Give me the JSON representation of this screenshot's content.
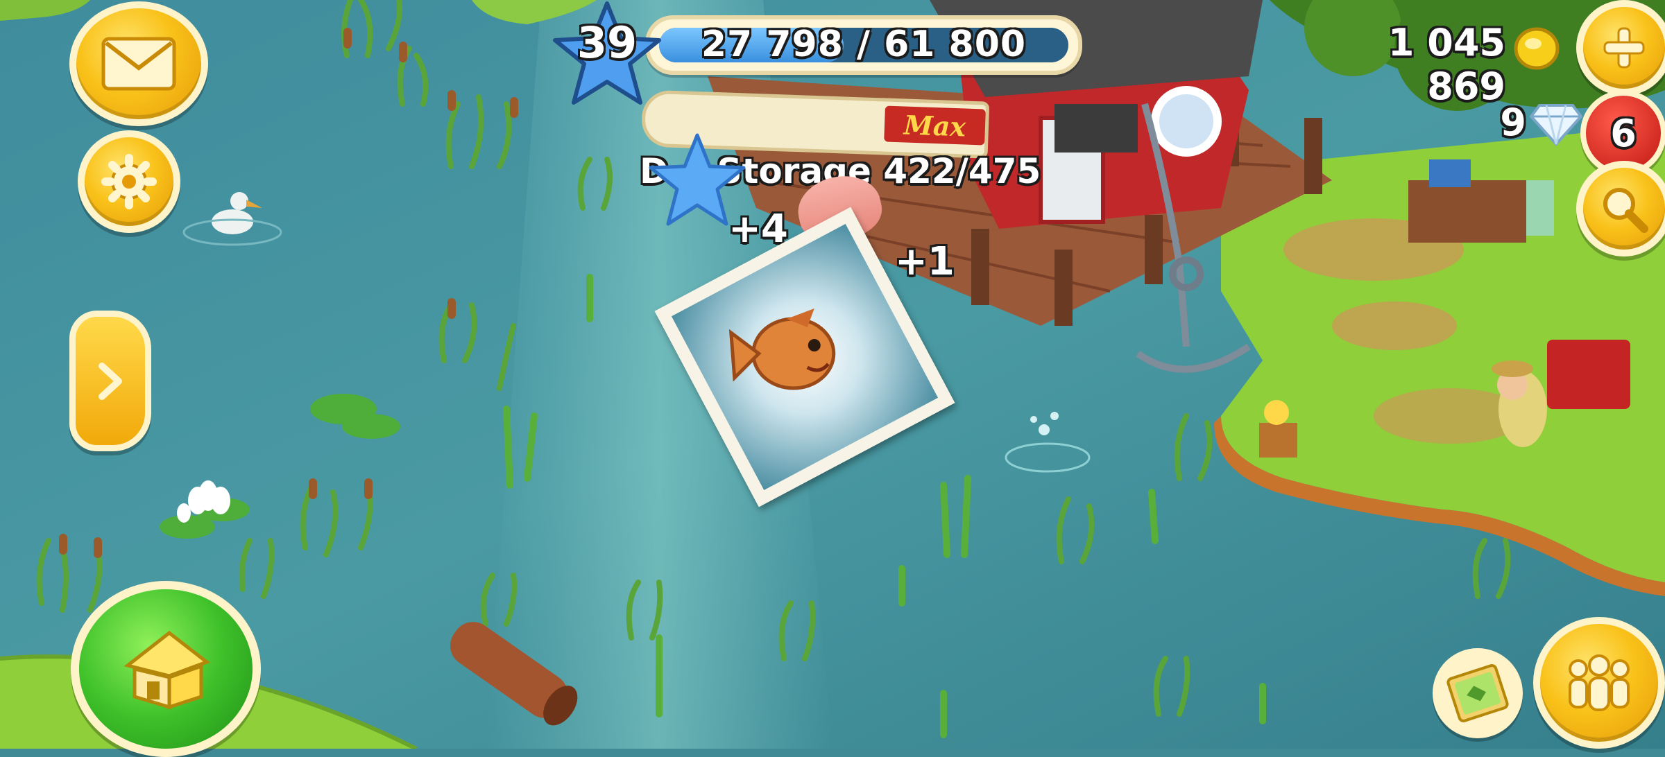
{
  "hud": {
    "level": "39",
    "xp_progress_text": "27 798 / 61 800",
    "xp_fraction": 0.45,
    "coins": "1 045 869",
    "diamonds": "9",
    "notification_count": "6"
  },
  "storage_popup": {
    "label": "Max",
    "storage_text": "Storage 422/475",
    "storage_prefix": "D",
    "xp_gain": "+4",
    "item_gain": "+1"
  },
  "icons": {
    "mail": "envelope-icon",
    "settings": "gear-icon",
    "expand": "chevron-right-icon",
    "home": "house-icon",
    "add": "plus-icon",
    "search": "magnifier-icon",
    "friends": "people-icon",
    "map": "map-card-icon",
    "coin": "coin-icon",
    "diamond": "diamond-icon",
    "level_star": "star-icon"
  },
  "colors": {
    "water": "#3f8a95",
    "grass": "#8fcf3a",
    "gold": "#f9c21a",
    "red_badge": "#d8221c",
    "xp_bar": "#4aa6ea"
  }
}
